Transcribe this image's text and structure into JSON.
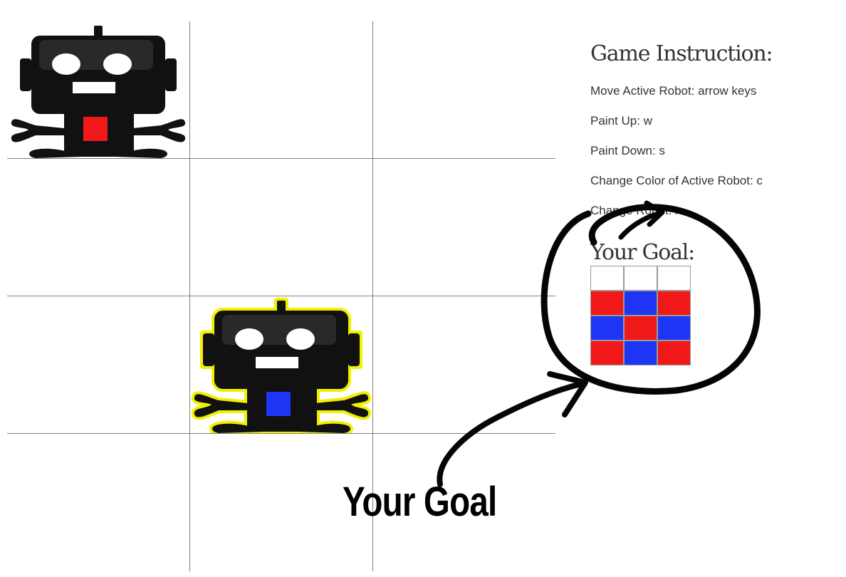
{
  "board": {
    "rows": 4,
    "cols": 3,
    "robots": [
      {
        "name": "robot-1",
        "row": 0,
        "col": 0,
        "color": "#f01818",
        "active": false
      },
      {
        "name": "robot-2",
        "row": 2,
        "col": 1,
        "color": "#1f35f5",
        "active": true
      }
    ],
    "active_outline_color": "#f0f000"
  },
  "instructions": {
    "title": "Game Instruction:",
    "items": [
      "Move Active Robot: arrow keys",
      "Paint Up: w",
      "Paint Down: s",
      "Change Color of Active Robot: c",
      "Change Robot: x"
    ]
  },
  "goal": {
    "title": "Your Goal:",
    "grid": [
      [
        "#ffffff",
        "#ffffff",
        "#ffffff"
      ],
      [
        "#f01818",
        "#1f35f5",
        "#f01818"
      ],
      [
        "#1f35f5",
        "#f01818",
        "#1f35f5"
      ],
      [
        "#f01818",
        "#1f35f5",
        "#f01818"
      ]
    ]
  },
  "annotation": {
    "label": "Your Goal"
  }
}
